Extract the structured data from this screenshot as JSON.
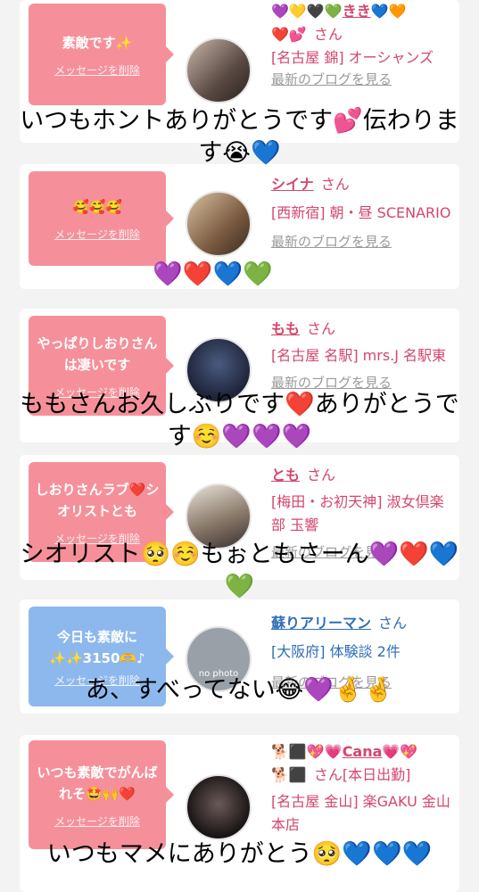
{
  "colors": {
    "pink_bubble": "#f5909a",
    "blue_bubble": "#8db8ee",
    "name_pink": "#d4466c",
    "name_blue": "#2e6fb8"
  },
  "delete_label": "メッセージを削除",
  "blog_label": "最新のブログを見る",
  "cards": [
    {
      "message": "素敵です✨",
      "name": "きき",
      "name_prefix": "💜💛🖤💚",
      "name_suffix": "💙🧡",
      "name_line2": "❤️💕",
      "san": "さん",
      "location": "[名古屋 錦] オーシャンズ",
      "overlay": "いつもホントありがとうです💕伝わります😭💙"
    },
    {
      "message": "🥰🥰🥰",
      "name": "シイナ",
      "san": "さん",
      "location": "[西新宿] 朝・昼 SCENARIO",
      "overlay": "💜❤️💙💚"
    },
    {
      "message": "やっぱりしおりさんは凄いです",
      "name": "もも",
      "san": "さん",
      "location": "[名古屋 名駅] mrs.J 名駅東",
      "overlay": "ももさんお久しぶりです❤️ありがとうです☺️💜💜💜"
    },
    {
      "message": "しおりさんラブ❤️シオリストとも",
      "name": "とも",
      "san": "さん",
      "location": "[梅田・お初天神] 淑女倶楽部 玉響",
      "overlay": "シオリスト🥺☺️もぉともさーん💜❤️💙💚"
    },
    {
      "message": "今日も素敵に✨✨3150🫶♪",
      "name": "蘇りアリーマン",
      "san": "さん",
      "location": "[大阪府] 体験談 2件",
      "avatar_text": "no photo",
      "overlay": "あ、すべってない😂💜🤞🤞"
    },
    {
      "message": "いつも素敵でがんばれそ🤩🙌❤️",
      "name": "Cana",
      "name_prefix": "🐕⬛💖💗",
      "name_suffix": "💗💖",
      "name_line2": "🐕⬛",
      "san": "さん[本日出勤]",
      "location": "[名古屋 金山] 楽GAKU 金山本店",
      "overlay": "いつもマメにありがとう🥺💙💙💙"
    }
  ]
}
